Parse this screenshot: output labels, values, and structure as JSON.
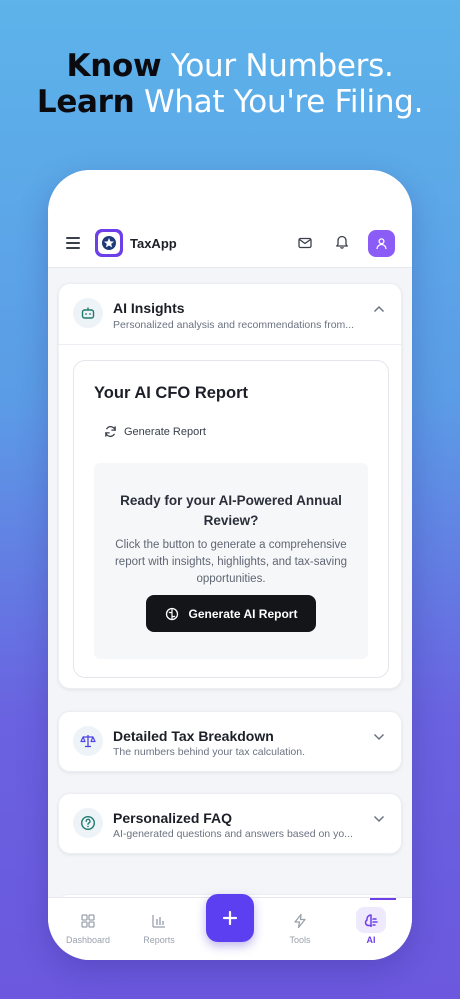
{
  "headline": {
    "line1_bold": "Know",
    "line1_rest": " Your Numbers.",
    "line2_bold": "Learn",
    "line2_rest": " What You're Filing."
  },
  "header": {
    "brand": "TaxApp",
    "icons": [
      "menu-icon",
      "logo-icon",
      "mail-icon",
      "bell-icon",
      "user-icon"
    ]
  },
  "ai_insights": {
    "title": "AI Insights",
    "subtitle": "Personalized analysis and recommendations from...",
    "report": {
      "title": "Your AI CFO Report",
      "generate_link": "Generate Report",
      "ready_title": "Ready for your AI-Powered Annual Review?",
      "ready_desc": "Click the button to generate a comprehensive report with insights, highlights, and tax-saving opportunities.",
      "button": "Generate AI Report"
    }
  },
  "tax_breakdown": {
    "title": "Detailed Tax Breakdown",
    "subtitle": "The numbers behind your tax calculation."
  },
  "faq": {
    "title": "Personalized FAQ",
    "subtitle": "AI-generated questions and answers based on yo..."
  },
  "nav": {
    "dashboard": "Dashboard",
    "reports": "Reports",
    "tools": "Tools",
    "ai": "AI",
    "fab": "+"
  },
  "colors": {
    "accent": "#6d3fe8",
    "fab": "#5b3ff0",
    "button_dark": "#141518"
  }
}
